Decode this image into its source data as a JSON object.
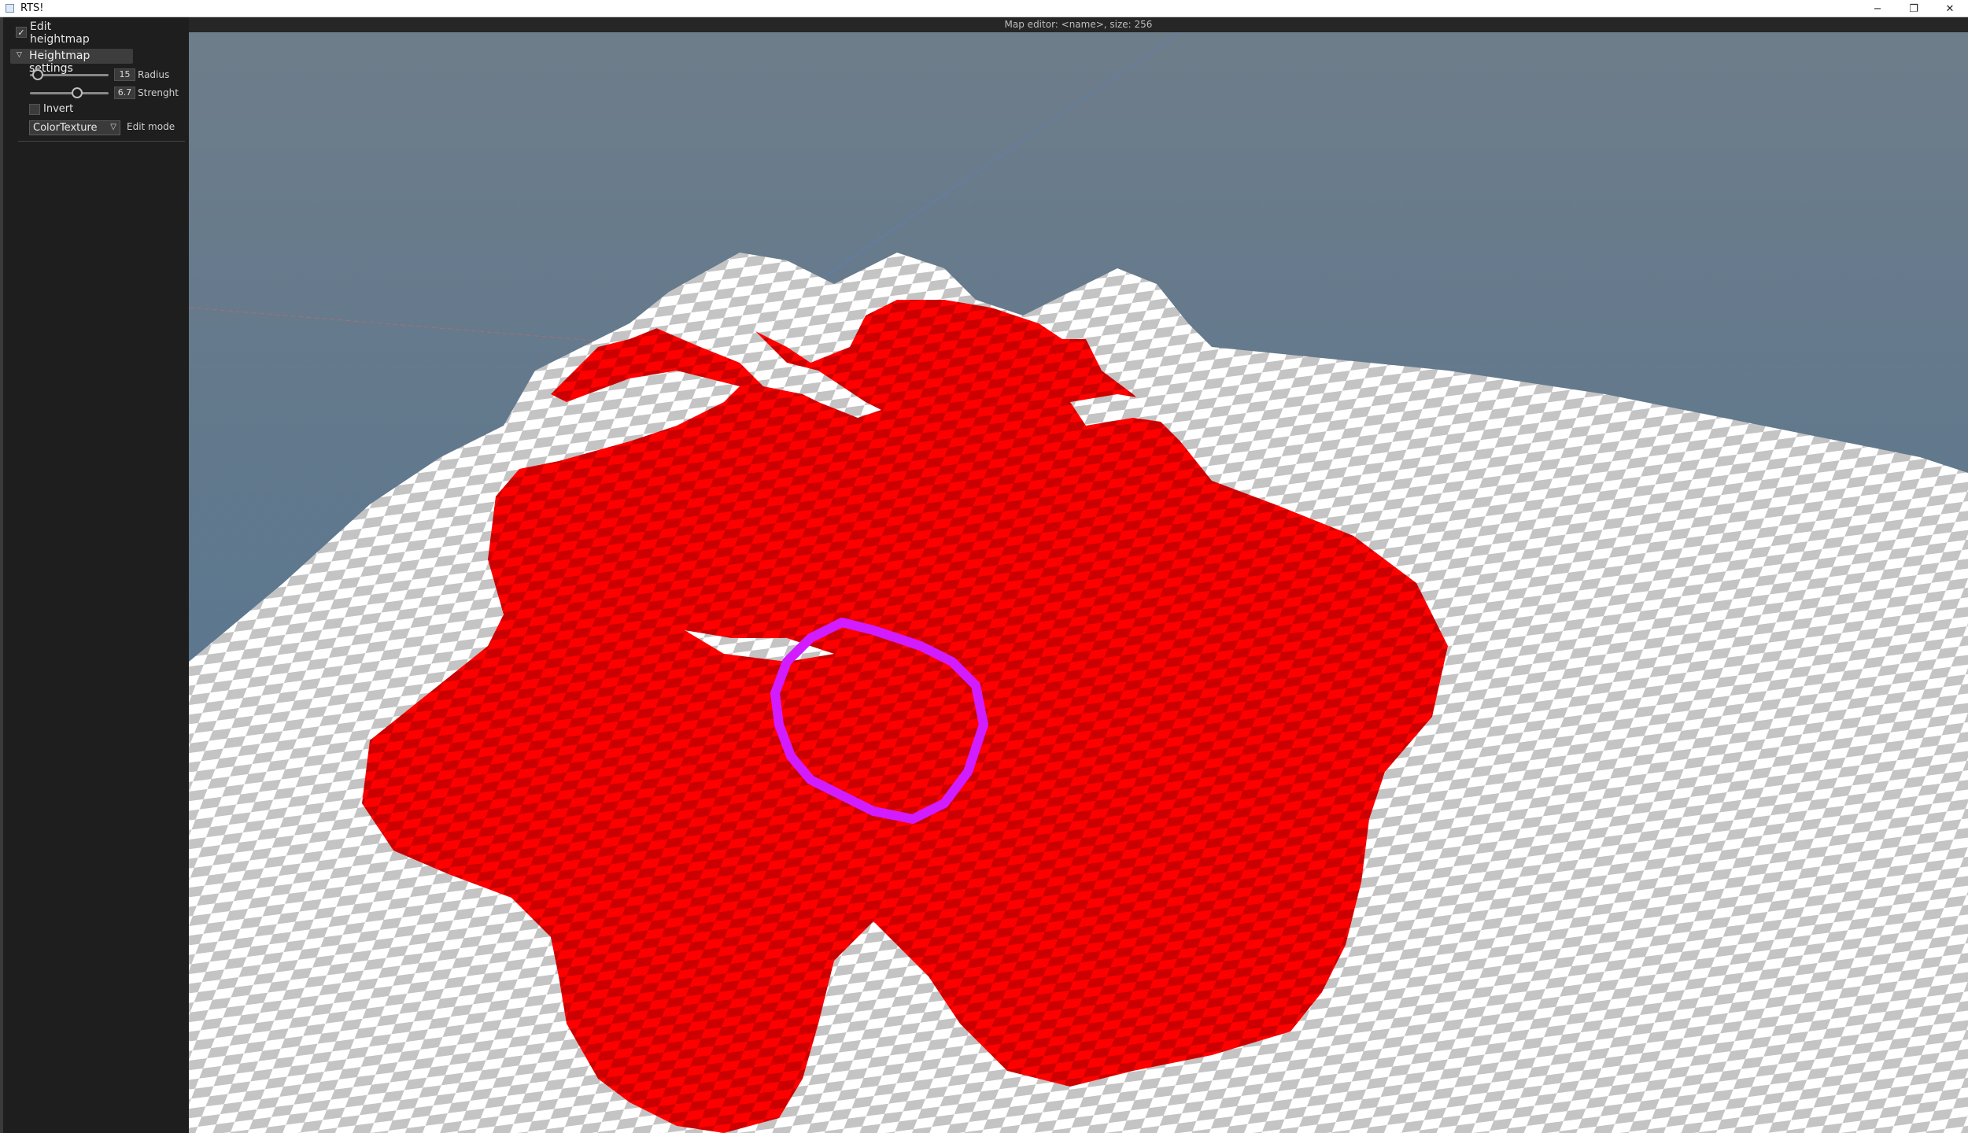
{
  "window": {
    "title": "RTS!",
    "icon": "app-window-icon",
    "controls": {
      "minimize": "−",
      "restore": "❐",
      "close": "✕"
    }
  },
  "sidebar": {
    "edit_heightmap": {
      "label": "Edit heightmap",
      "checked": true,
      "check_glyph": "✓"
    },
    "heightmap_settings": {
      "label": "Heightmap settings",
      "expanded": true,
      "arrow_glyph": "▽"
    },
    "radius": {
      "value": "15",
      "label": "Radius",
      "slider_fraction": 0.1
    },
    "strength": {
      "value": "6.7",
      "label": "Strenght",
      "slider_fraction": 0.6
    },
    "invert": {
      "label": "Invert",
      "checked": false
    },
    "edit_mode": {
      "value": "ColorTexture",
      "label": "Edit mode",
      "arrow_glyph": "▽"
    }
  },
  "viewport": {
    "title": "Map editor: <name>, size: 256"
  },
  "colors": {
    "sky_top": "#6e7d8a",
    "sky_bottom": "#4e7291",
    "grid_line": "#5b7fa0",
    "checker_light": "#ffffff",
    "checker_dark": "#c4c4c4",
    "paint_red": "#ff0000",
    "paint_red_dark": "#cc0000",
    "brush_ring": "#d21bff",
    "sidebar_bg": "#1e1e1e"
  }
}
